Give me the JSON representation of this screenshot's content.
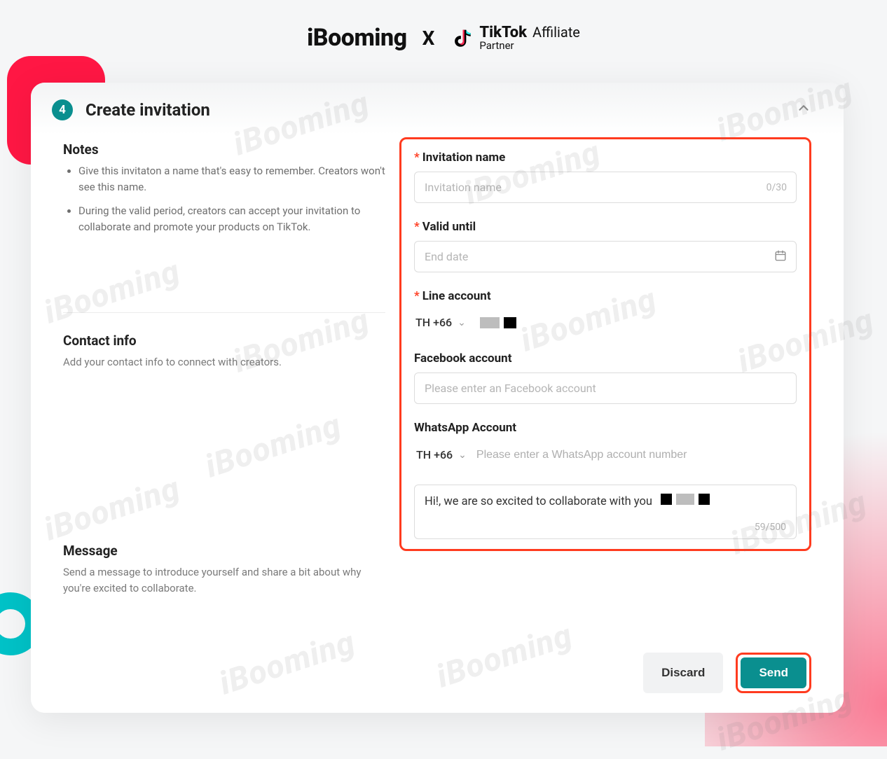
{
  "brand": {
    "ibooming": "iBooming",
    "x": "X",
    "tiktok": "TikTok",
    "affiliate": "Affiliate",
    "partner": "Partner"
  },
  "watermark": "iBooming",
  "step": {
    "number": "4",
    "title": "Create invitation"
  },
  "left": {
    "notes_header": "Notes",
    "note1": "Give this invitaton a name that's easy to remember. Creators won't see this name.",
    "note2": "During the valid period, creators can accept your invitation to collaborate and promote your products on TikTok.",
    "contact_header": "Contact info",
    "contact_sub": "Add your contact info to connect with creators.",
    "message_header": "Message",
    "message_sub": "Send a message to introduce yourself and share a bit about why you're excited to collaborate."
  },
  "form": {
    "invitation_label": "Invitation name",
    "invitation_placeholder": "Invitation name",
    "invitation_counter": "0/30",
    "valid_label": "Valid until",
    "valid_placeholder": "End date",
    "line_label": "Line account",
    "line_dial": "TH +66",
    "facebook_label": "Facebook account",
    "facebook_placeholder": "Please enter an Facebook account",
    "whatsapp_label": "WhatsApp Account",
    "whatsapp_dial": "TH +66",
    "whatsapp_placeholder": "Please enter a WhatsApp account number",
    "message_value": "Hi!, we are so excited to collaborate with you",
    "message_counter": "59/500"
  },
  "footer": {
    "discard": "Discard",
    "send": "Send"
  }
}
